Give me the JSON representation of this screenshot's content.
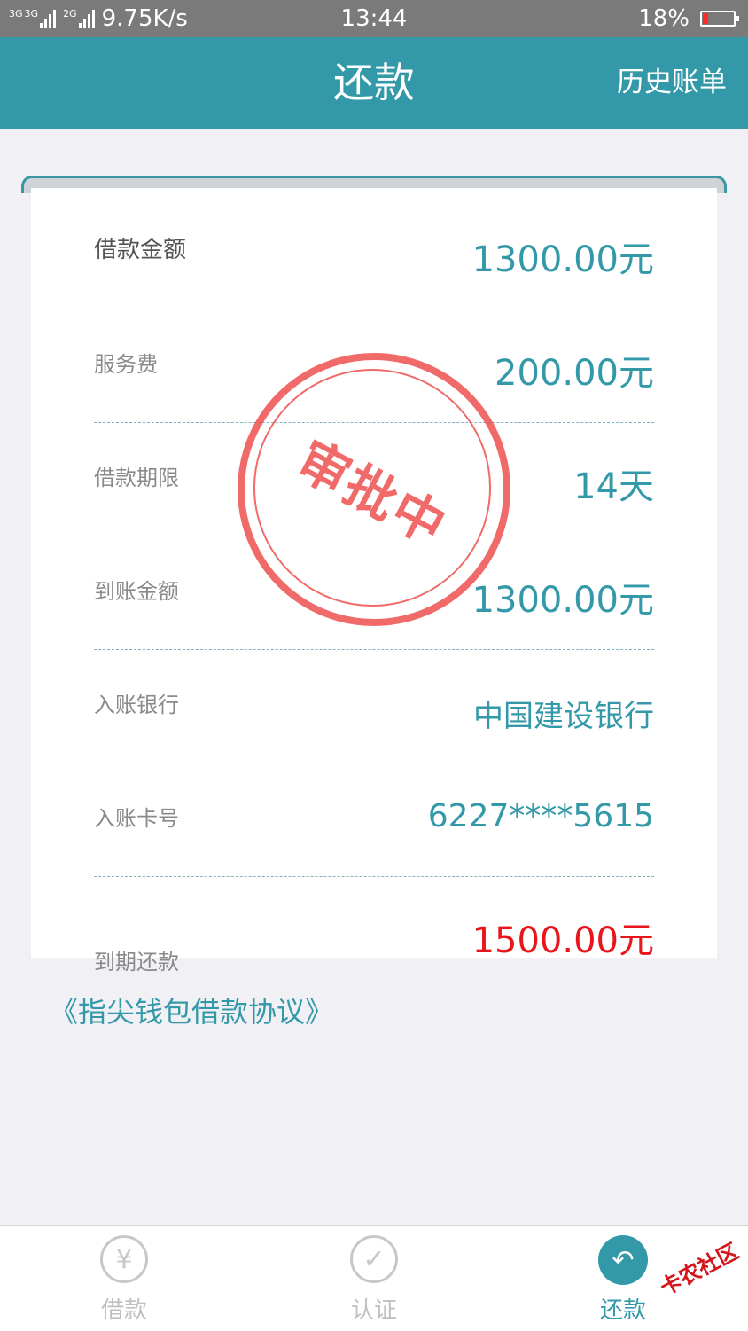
{
  "status_bar": {
    "net1": "3G",
    "net2": "3G",
    "net3": "2G",
    "speed": "9.75K/s",
    "time": "13:44",
    "battery": "18%",
    "battery_level": 0.18
  },
  "header": {
    "title": "还款",
    "history_label": "历史账单"
  },
  "details": [
    {
      "label": "借款金额",
      "value": "1300.00元"
    },
    {
      "label": "服务费",
      "value": "200.00元"
    },
    {
      "label": "借款期限",
      "value": "14天"
    },
    {
      "label": "到账金额",
      "value": "1300.00元"
    },
    {
      "label": "入账银行",
      "value": "中国建设银行"
    },
    {
      "label": "入账卡号",
      "value": "6227****5615"
    },
    {
      "label": "到期还款",
      "value": "1500.00元"
    }
  ],
  "stamp": {
    "text": "审批中",
    "color": "#ef4a4a"
  },
  "agreement": "《指尖钱包借款协议》",
  "tabs": [
    {
      "label": "借款",
      "icon": "yen-icon",
      "glyph": "¥"
    },
    {
      "label": "认证",
      "icon": "check-icon",
      "glyph": "✓"
    },
    {
      "label": "还款",
      "icon": "return-icon",
      "glyph": "↶"
    }
  ],
  "watermark": "卡农社区",
  "colors": {
    "accent": "#3399a8",
    "due": "#e8151b"
  }
}
